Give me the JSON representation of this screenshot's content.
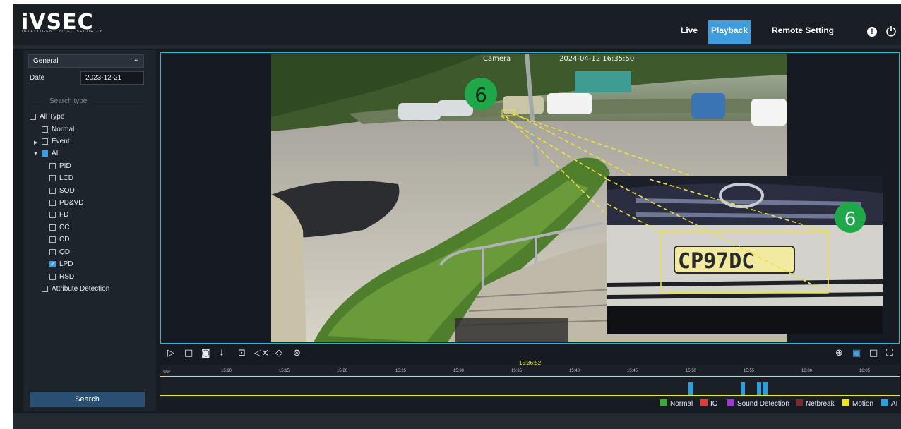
{
  "app": {
    "logo": "iVSEC",
    "logo_sub": "INTELLIGENT VIDEO SECURITY"
  },
  "nav": {
    "live": "Live",
    "playback": "Playback",
    "remote_setting": "Remote Setting"
  },
  "sidebar": {
    "mode_select": "General",
    "date_label": "Date",
    "date_value": "2023-12-21",
    "search_type_label": "Search type",
    "all_type": "All Type",
    "normal": "Normal",
    "event": "Event",
    "ai": "AI",
    "ai_items": [
      "PID",
      "LCD",
      "SOD",
      "PD&VD",
      "FD",
      "CC",
      "CD",
      "QD",
      "LPD",
      "RSD"
    ],
    "attribute_detection": "Attribute Detection",
    "search_button": "Search"
  },
  "video": {
    "overlay_camera": "Camera",
    "overlay_timestamp": "2024-04-12 16:35:50",
    "marker_number": "6"
  },
  "timeline": {
    "current_time": "15:36:52",
    "ticks": [
      "15:10",
      "15:15",
      "15:20",
      "15:25",
      "15:30",
      "15:35",
      "15:40",
      "15:45",
      "15:50",
      "15:55",
      "16:00",
      "16:05"
    ]
  },
  "legend": [
    {
      "label": "Normal",
      "color": "#3aa83a"
    },
    {
      "label": "IO",
      "color": "#e03a3a"
    },
    {
      "label": "Sound Detection",
      "color": "#a035d8"
    },
    {
      "label": "Netbreak",
      "color": "#7a2a2a"
    },
    {
      "label": "Motion",
      "color": "#f2e21a"
    },
    {
      "label": "AI",
      "color": "#2d9ee0"
    }
  ],
  "colors": {
    "accent": "#3d9de0",
    "pane_border": "#2fb6d8",
    "marker": "#1fa84a"
  }
}
